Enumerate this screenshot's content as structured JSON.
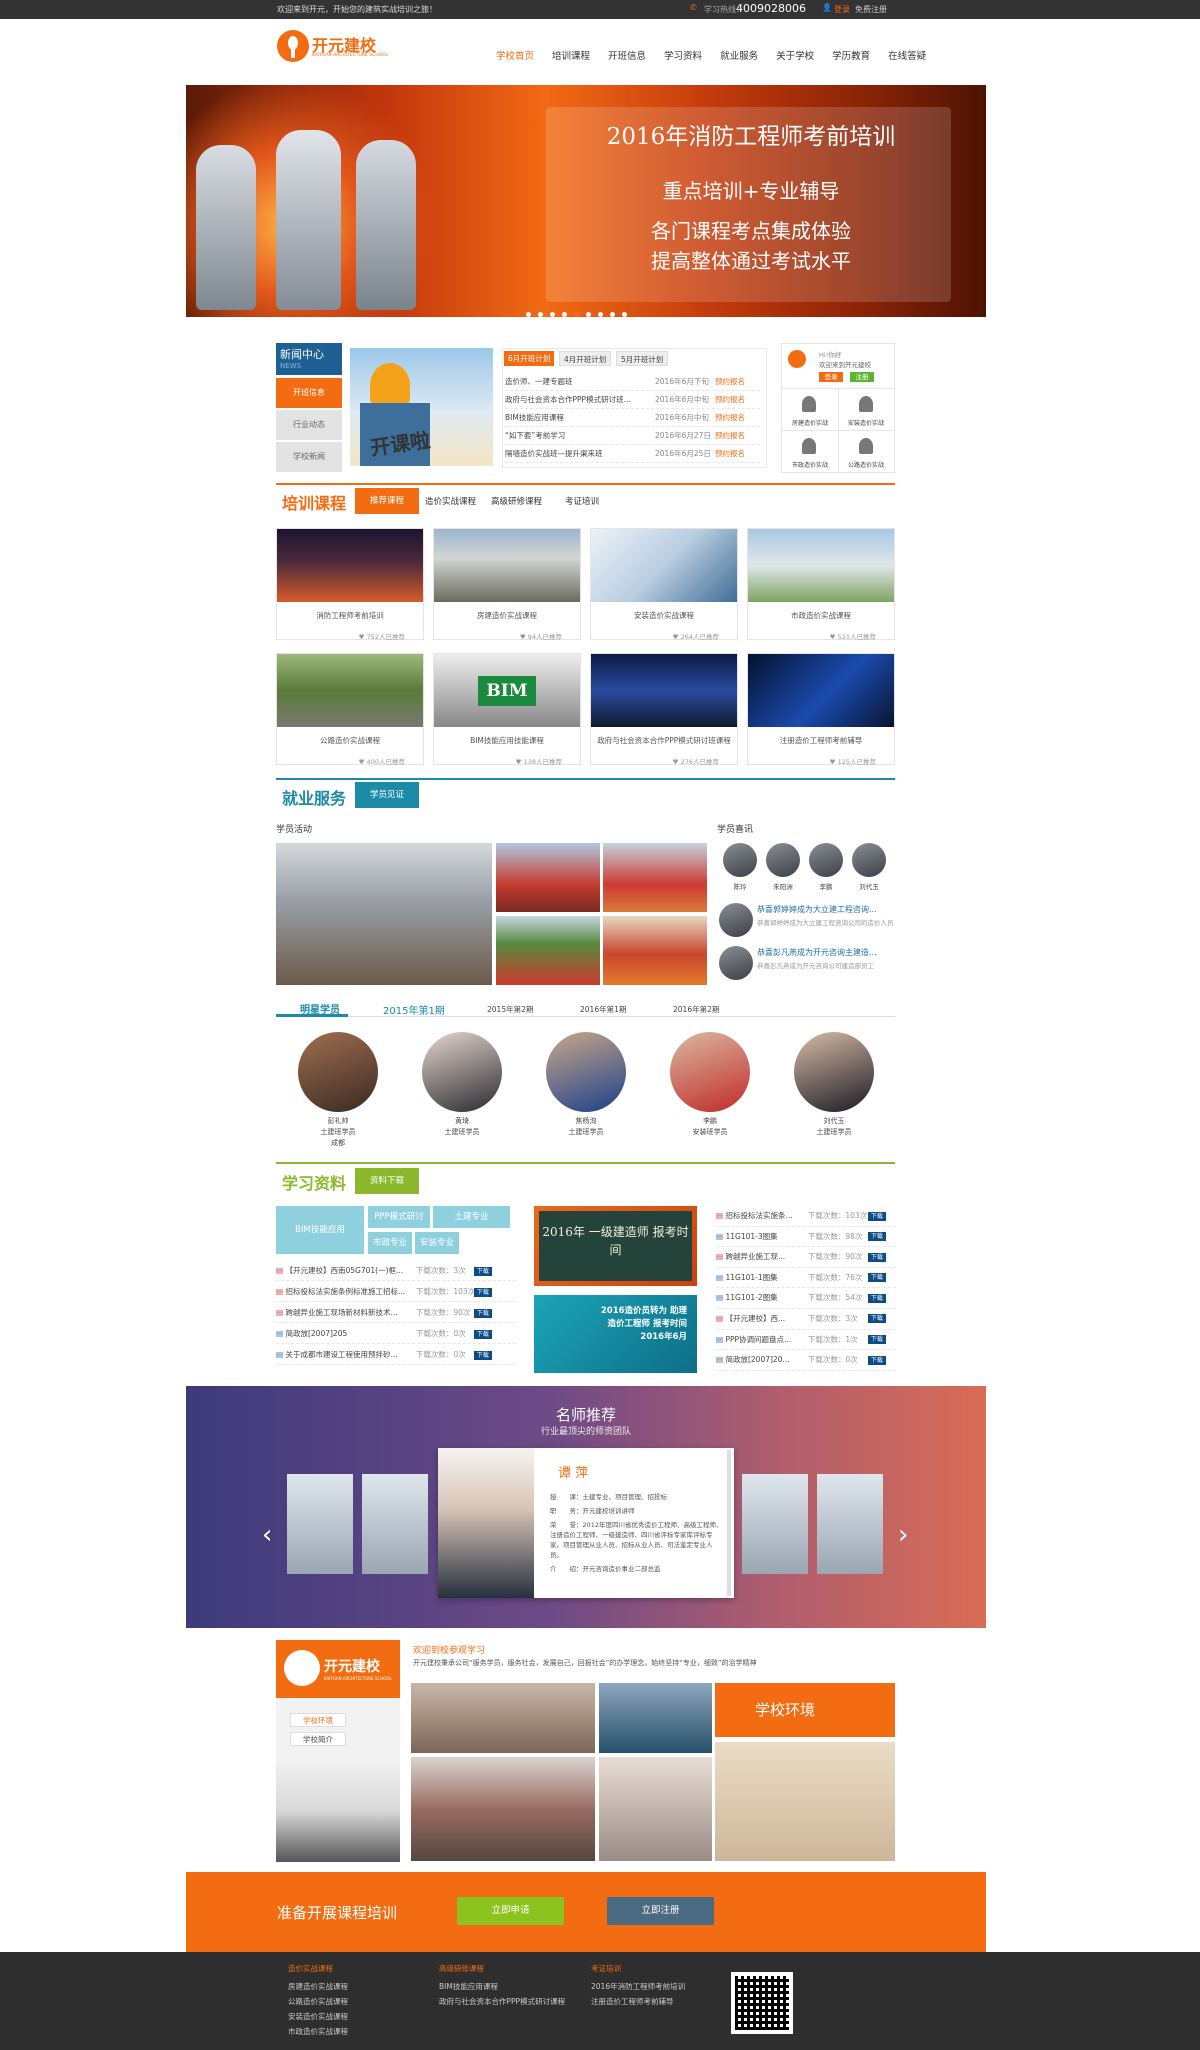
{
  "topbar": {
    "welcome": "欢迎来到开元，开始您的建筑实战培训之旅！",
    "hotline_label": "学习热线：",
    "hotline": "4009028006",
    "login": "登录",
    "register": "免费注册"
  },
  "header": {
    "logo_cn": "开元建校",
    "logo_en": "KAIYUAN ARCHITECTURE SCHOOL",
    "nav": [
      "学校首页",
      "培训课程",
      "开班信息",
      "学习资料",
      "就业服务",
      "关于学校",
      "学历教育",
      "在线答疑"
    ]
  },
  "banner": {
    "title": "2016年消防工程师考前培训",
    "line1": "重点培训+专业辅导",
    "line2": "各门课程考点集成体验",
    "line3": "提高整体通过考试水平",
    "dots": 9
  },
  "news": {
    "title": "新闻中心",
    "sub": "NEWS",
    "menu": [
      "开班信息",
      "行业动态",
      "学校新闻"
    ],
    "img_text": "开课啦",
    "tabs": [
      "6月开班计划",
      "4月开班计划",
      "5月开班计划"
    ],
    "items": [
      {
        "t": "造价师、一建专题班",
        "d": "2016年6月下旬",
        "s": "预约报名"
      },
      {
        "t": "政府与社会资本合作PPP模式研讨班...",
        "d": "2016年6月中旬",
        "s": "预约报名"
      },
      {
        "t": "BIM技能应用课程",
        "d": "2016年6月中旬",
        "s": "预约报名"
      },
      {
        "t": "“如下套”考前学习",
        "d": "2016年6月27日",
        "s": "预约报名"
      },
      {
        "t": "隔墙造价实战班—提升渠来班",
        "d": "2016年6月25日",
        "s": "预约报名"
      }
    ]
  },
  "login": {
    "greeting": "Hi!你好",
    "welcome": "欢迎来到开元建校",
    "login": "登录",
    "register": "注册",
    "services": [
      "房建造价实战",
      "安装造价实战",
      "市政造价实战",
      "公路造价实战"
    ]
  },
  "courses": {
    "title": "培训课程",
    "tabs": [
      "推荐课程",
      "造价实战课程",
      "高级研修课程",
      "考证培训"
    ],
    "items": [
      {
        "name": "消防工程师考前培训",
        "n": "752人已推荐"
      },
      {
        "name": "房建造价实战课程",
        "n": "94人已推荐"
      },
      {
        "name": "安装造价实战课程",
        "n": "264人已推荐"
      },
      {
        "name": "市政造价实战课程",
        "n": "521人已推荐"
      },
      {
        "name": "公路造价实战课程",
        "n": "400人已推荐"
      },
      {
        "name": "BIM技能应用技能课程",
        "n": "138人已推荐"
      },
      {
        "name": "政府与社会资本合作PPP模式研讨班课程",
        "n": "276人已推荐"
      },
      {
        "name": "注册造价工程师考前辅导",
        "n": "125人已推荐"
      }
    ],
    "bim": "BIM"
  },
  "jobs": {
    "title": "就业服务",
    "tab": "学员见证",
    "activity": "学员活动",
    "happy": "学员喜讯",
    "avatars": [
      "陈玲",
      "朱阳洲",
      "李鹏",
      "刘代玉"
    ],
    "news": [
      {
        "t": "恭喜郭婷婷成为大立建工程咨询...",
        "d": "恭喜郭婷婷成为大立建工程咨询公司的造价人员"
      },
      {
        "t": "恭喜彭凡燕成为开元咨询主建造...",
        "d": "恭喜彭凡燕成为开元咨询公司建造部员工"
      }
    ],
    "star_tabs": [
      "明星学员",
      "2015年第1期",
      "2015年第2期",
      "2016年第1期",
      "2016年第2期"
    ],
    "stars": [
      {
        "name": "彭礼帅",
        "role": "土建班学员",
        "city": "成都"
      },
      {
        "name": "黄琦",
        "role": "土建班学员",
        "city": ""
      },
      {
        "name": "焦杨洵",
        "role": "土建班学员",
        "city": ""
      },
      {
        "name": "李鹏",
        "role": "安装班学员",
        "city": ""
      },
      {
        "name": "刘代玉",
        "role": "土建班学员",
        "city": ""
      }
    ]
  },
  "materials": {
    "title": "学习资料",
    "tab": "资料下载",
    "cats": [
      "BIM技能应用",
      "PPP模式研讨",
      "土建专业",
      "市政专业",
      "安装专业"
    ],
    "dl": "下载",
    "left": [
      {
        "t": "【开元建校】西南05G701(一)框...",
        "c": "下载次数：3次"
      },
      {
        "t": "招标投标法实施条例标准施工招标...",
        "c": "下载次数：103次"
      },
      {
        "t": "跨越异业施工现场新材料新技术...",
        "c": "下载次数：90次"
      },
      {
        "t": "简政放[2007]205",
        "c": "下载次数：0次"
      },
      {
        "t": "关于成都市建设工程使用预拌砂...",
        "c": "下载次数：0次"
      }
    ],
    "ad1": "2016年 一级建造师 报考时间",
    "ad2": "2016造价员转为 助理造价工程师 报考时间2016年6月",
    "right": [
      {
        "t": "招标投标法实施条...",
        "c": "下载次数：103次"
      },
      {
        "t": "11G101-3图集",
        "c": "下载次数：98次"
      },
      {
        "t": "跨越异业施工现...",
        "c": "下载次数：90次"
      },
      {
        "t": "11G101-1图集",
        "c": "下载次数：76次"
      },
      {
        "t": "11G101-2图集",
        "c": "下载次数：54次"
      },
      {
        "t": "【开元建校】西...",
        "c": "下载次数：3次"
      },
      {
        "t": "PPP协调问题盘点...",
        "c": "下载次数：1次"
      },
      {
        "t": "简政放[2007]20...",
        "c": "下载次数：0次"
      }
    ]
  },
  "teachers": {
    "title": "名师推荐",
    "sub": "行业最顶尖的师资团队",
    "name": "谭 萍",
    "info": [
      {
        "k": "授　　课：",
        "v": "土建专业、项目管理、招投标"
      },
      {
        "k": "职　　务：",
        "v": "开元建校培训讲师"
      },
      {
        "k": "荣　　誉：",
        "v": "2012年度四川省优秀造价工程师、高级工程师、注册造价工程师、一级建造师、四川省评标专家库评标专家。项目管理从业人员、招标从业人员、司法鉴定专业人员。"
      },
      {
        "k": "介　　绍：",
        "v": "开元咨询造价事业二部总监"
      }
    ]
  },
  "about": {
    "logo_cn": "开元建校",
    "logo_en": "KAIYUAN ARCHITECTURE SCHOOL",
    "menu": [
      "学校环境",
      "学校简介"
    ],
    "welcome": "欢迎到校参观学习",
    "desc": "开元建校秉承公司“服务学员，服务社会，发展自己，回报社会”的办学理念，始终坚持“专业，细致”的治学精神",
    "env": "学校环境"
  },
  "cta": {
    "text": "准备开展课程培训",
    "apply": "立即申请",
    "reg": "立即注册"
  },
  "footer": {
    "cols": [
      {
        "h": "造价实战课程",
        "items": [
          "房建造价实战课程",
          "公路造价实战课程",
          "安装造价实战课程",
          "市政造价实战课程"
        ]
      },
      {
        "h": "高级研修课程",
        "items": [
          "BIM技能应用课程",
          "政府与社会资本合作PPP模式研讨课程"
        ]
      },
      {
        "h": "考证培训",
        "items": [
          "2016年消防工程师考前培训",
          "注册造价工程师考前辅导"
        ]
      }
    ]
  }
}
